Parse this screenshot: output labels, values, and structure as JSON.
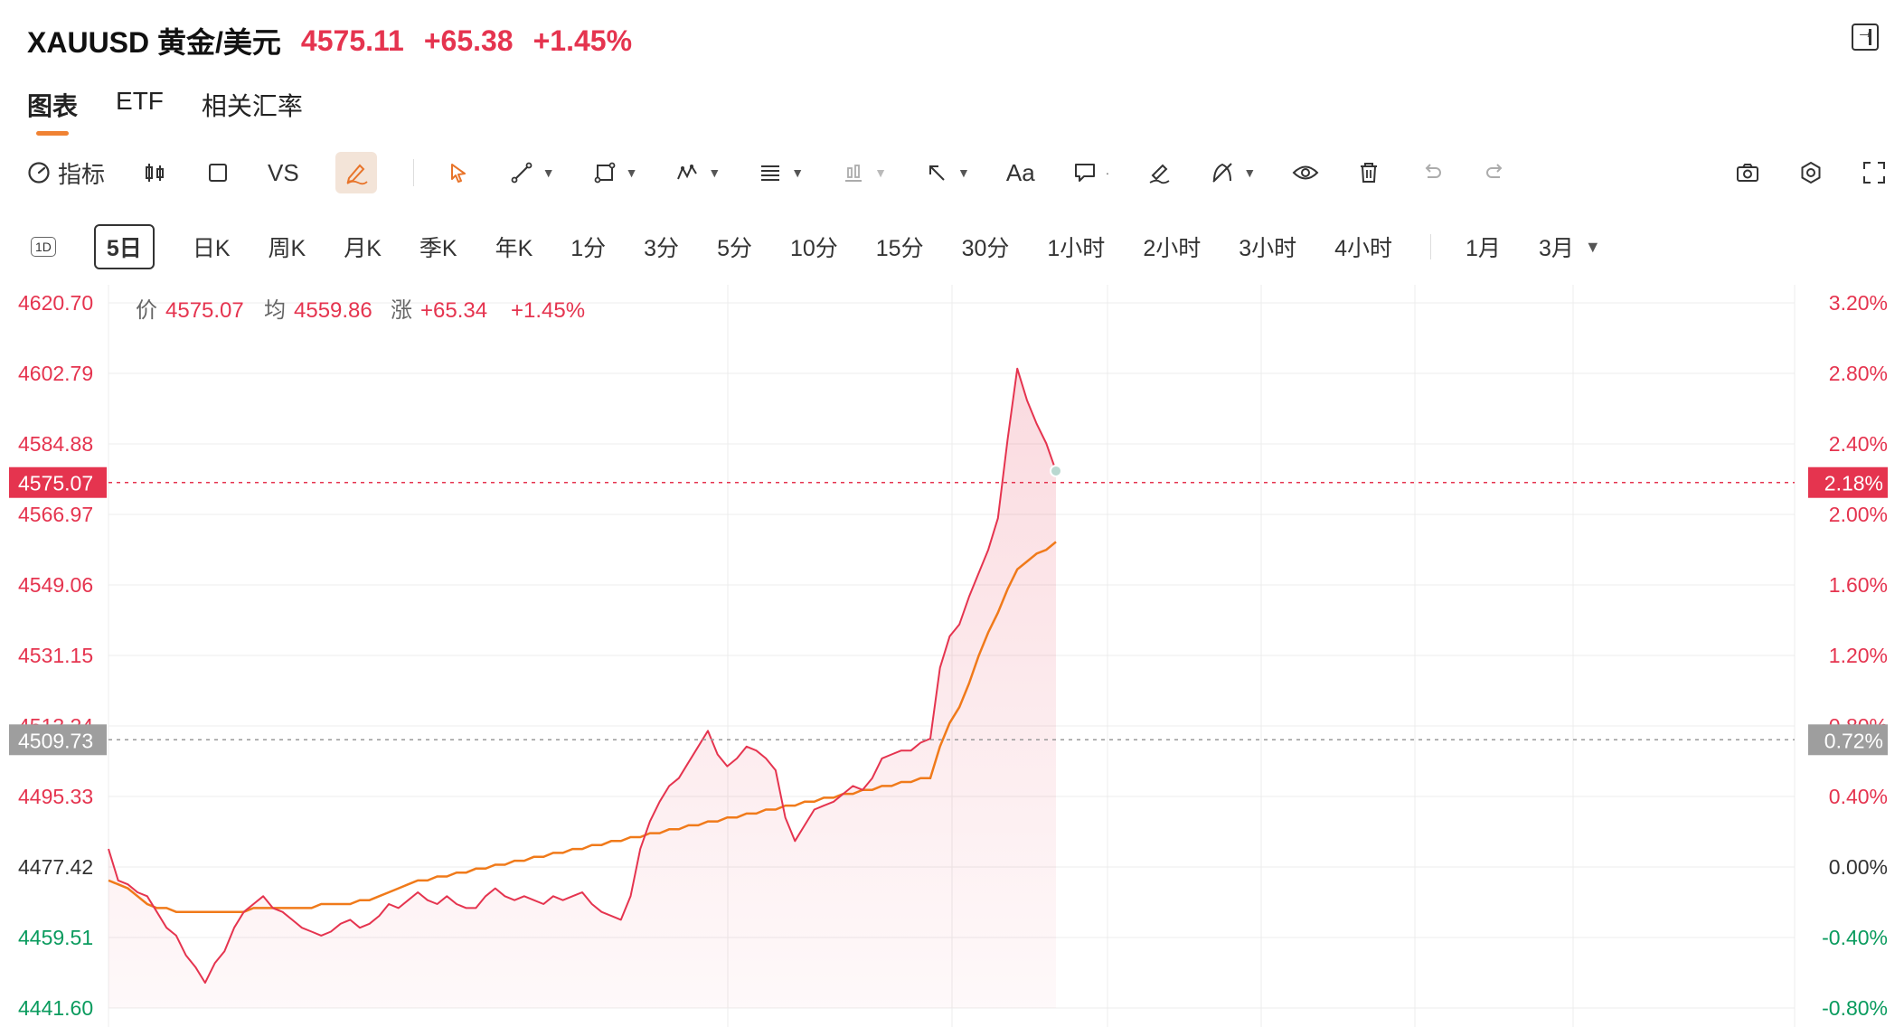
{
  "header": {
    "symbol": "XAUUSD 黄金/美元",
    "price": "4575.11",
    "change": "+65.38",
    "change_pct": "+1.45%"
  },
  "tabs": [
    {
      "label": "图表",
      "active": true
    },
    {
      "label": "ETF",
      "active": false
    },
    {
      "label": "相关汇率",
      "active": false
    }
  ],
  "toolbar": {
    "indicator_label": "指标",
    "vs_label": "VS",
    "text_label": "Aa"
  },
  "periods": [
    "5日",
    "日K",
    "周K",
    "月K",
    "季K",
    "年K",
    "1分",
    "3分",
    "5分",
    "10分",
    "15分",
    "30分",
    "1小时",
    "2小时",
    "3小时",
    "4小时"
  ],
  "period_1d_badge": "1D",
  "period_active": "5日",
  "periods_extra": [
    "1月",
    "3月"
  ],
  "info_bar": {
    "price_label": "价",
    "price_value": "4575.07",
    "avg_label": "均",
    "avg_value": "4559.86",
    "chg_label": "涨",
    "chg_value": "+65.34",
    "pct_value": "+1.45%"
  },
  "colors": {
    "up": "#e5344f",
    "down": "#0a9b5e",
    "avg_line": "#f07a1a",
    "grid": "#ececec"
  },
  "chart_data": {
    "type": "line",
    "y_left_ticks": [
      "4620.70",
      "4602.79",
      "4584.88",
      "4566.97",
      "4549.06",
      "4531.15",
      "4513.24",
      "4495.33",
      "4477.42",
      "4459.51",
      "4441.60"
    ],
    "y_right_ticks": [
      "3.20%",
      "2.80%",
      "2.40%",
      "2.00%",
      "1.60%",
      "1.20%",
      "0.80%",
      "0.40%",
      "0.00%",
      "-0.40%",
      "-0.80%"
    ],
    "ylim": [
      4441.6,
      4620.7
    ],
    "prev_close": 4477.42,
    "current_marker": {
      "price": "4575.07",
      "pct": "2.18%"
    },
    "ref_marker": {
      "price": "4509.73",
      "pct": "0.72%"
    },
    "series": [
      {
        "name": "价",
        "values": [
          4482,
          4474,
          4473,
          4471,
          4470,
          4466,
          4462,
          4460,
          4455,
          4452,
          4448,
          4453,
          4456,
          4462,
          4466,
          4468,
          4470,
          4467,
          4466,
          4464,
          4462,
          4461,
          4460,
          4461,
          4463,
          4464,
          4462,
          4463,
          4465,
          4468,
          4467,
          4469,
          4471,
          4469,
          4468,
          4470,
          4468,
          4467,
          4467,
          4470,
          4472,
          4470,
          4469,
          4470,
          4469,
          4468,
          4470,
          4469,
          4470,
          4471,
          4468,
          4466,
          4465,
          4464,
          4470,
          4482,
          4489,
          4494,
          4498,
          4500,
          4504,
          4508,
          4512,
          4506,
          4503,
          4505,
          4508,
          4507,
          4505,
          4502,
          4490,
          4484,
          4488,
          4492,
          4493,
          4494,
          4496,
          4498,
          4497,
          4500,
          4505,
          4506,
          4507,
          4507,
          4509,
          4510,
          4528,
          4536,
          4539,
          4546,
          4552,
          4558,
          4566,
          4586,
          4604,
          4596,
          4590,
          4585,
          4578
        ]
      },
      {
        "name": "均",
        "values": [
          4474,
          4473,
          4472,
          4470,
          4468,
          4467,
          4467,
          4466,
          4466,
          4466,
          4466,
          4466,
          4466,
          4466,
          4466,
          4467,
          4467,
          4467,
          4467,
          4467,
          4467,
          4467,
          4468,
          4468,
          4468,
          4468,
          4469,
          4469,
          4470,
          4471,
          4472,
          4473,
          4474,
          4474,
          4475,
          4475,
          4476,
          4476,
          4477,
          4477,
          4478,
          4478,
          4479,
          4479,
          4480,
          4480,
          4481,
          4481,
          4482,
          4482,
          4483,
          4483,
          4484,
          4484,
          4485,
          4485,
          4486,
          4486,
          4487,
          4487,
          4488,
          4488,
          4489,
          4489,
          4490,
          4490,
          4491,
          4491,
          4492,
          4492,
          4493,
          4493,
          4494,
          4494,
          4495,
          4495,
          4496,
          4496,
          4497,
          4497,
          4498,
          4498,
          4499,
          4499,
          4500,
          4500,
          4508,
          4514,
          4518,
          4524,
          4531,
          4537,
          4542,
          4548,
          4553,
          4555,
          4557,
          4558,
          4560
        ]
      }
    ]
  }
}
